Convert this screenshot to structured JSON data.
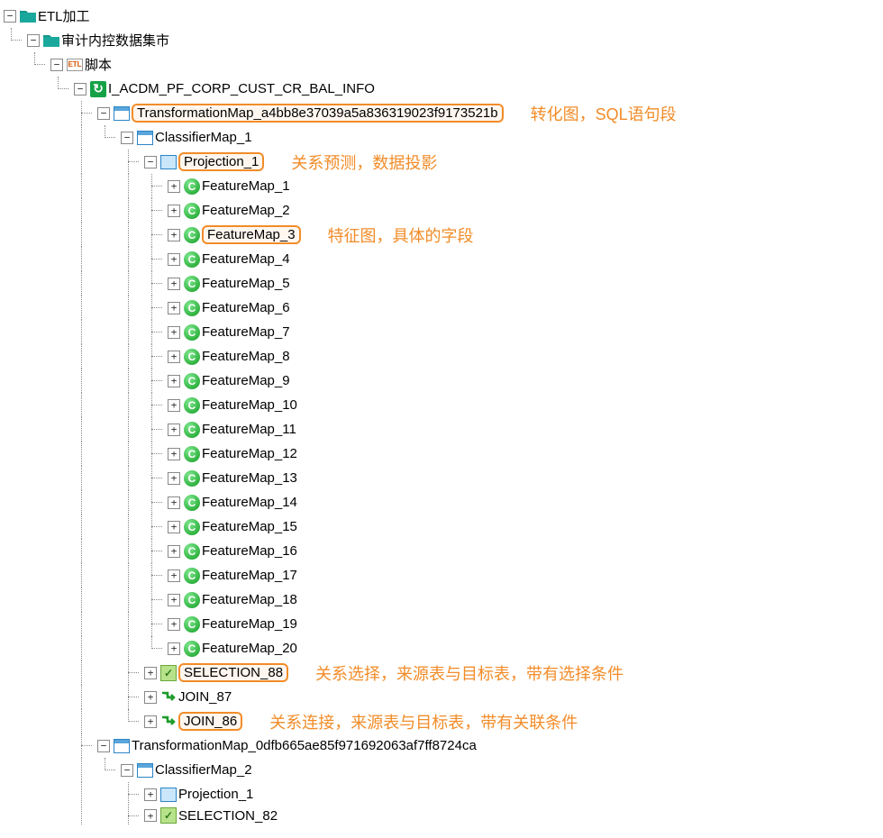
{
  "toggle": {
    "minus": "−",
    "plus": "+"
  },
  "icon_text": {
    "etl": "ETL",
    "refresh": "↻",
    "feature": "C"
  },
  "tree": {
    "root": "ETL加工",
    "datamart": "审计内控数据集市",
    "scripts": "脚本",
    "job": "I_ACDM_PF_CORP_CUST_CR_BAL_INFO",
    "tmap1": "TransformationMap_a4bb8e37039a5a836319023f9173521b",
    "cmap1": "ClassifierMap_1",
    "proj1": "Projection_1",
    "features": [
      "FeatureMap_1",
      "FeatureMap_2",
      "FeatureMap_3",
      "FeatureMap_4",
      "FeatureMap_5",
      "FeatureMap_6",
      "FeatureMap_7",
      "FeatureMap_8",
      "FeatureMap_9",
      "FeatureMap_10",
      "FeatureMap_11",
      "FeatureMap_12",
      "FeatureMap_13",
      "FeatureMap_14",
      "FeatureMap_15",
      "FeatureMap_16",
      "FeatureMap_17",
      "FeatureMap_18",
      "FeatureMap_19",
      "FeatureMap_20"
    ],
    "selection88": "SELECTION_88",
    "join87": "JOIN_87",
    "join86": "JOIN_86",
    "tmap2": "TransformationMap_0dfb665ae85f971692063af7ff8724ca",
    "cmap2": "ClassifierMap_2",
    "proj2": "Projection_1",
    "selection82": "SELECTION_82"
  },
  "annotations": {
    "tmap": "转化图，SQL语句段",
    "proj": "关系预测，数据投影",
    "feature": "特征图，具体的字段",
    "selection": "关系选择，来源表与目标表，带有选择条件",
    "join": "关系连接，来源表与目标表，带有关联条件"
  }
}
